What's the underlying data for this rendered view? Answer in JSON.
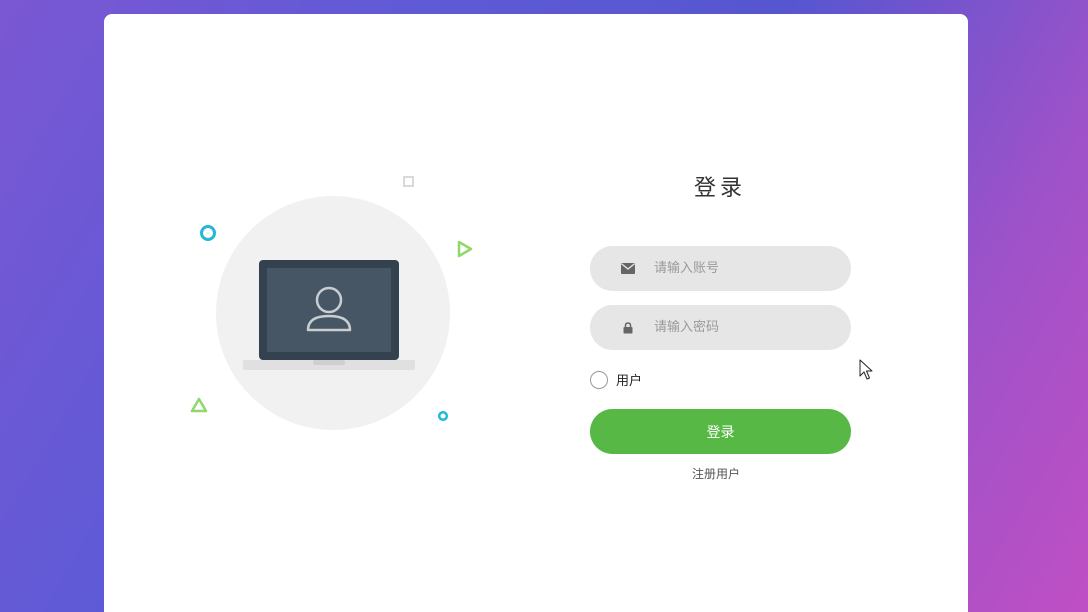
{
  "login": {
    "title": "登录",
    "account_placeholder": "请输入账号",
    "password_placeholder": "请输入密码",
    "role_label": "用户",
    "login_button": "登录",
    "register_link": "注册用户"
  },
  "icons": {
    "account": "envelope-icon",
    "password": "lock-icon",
    "illustration": "laptop-user-icon"
  },
  "colors": {
    "primary_button": "#57b846",
    "input_bg": "#e6e6e6",
    "deco_cyan": "#22b8d6",
    "deco_green": "#8ed96a"
  }
}
